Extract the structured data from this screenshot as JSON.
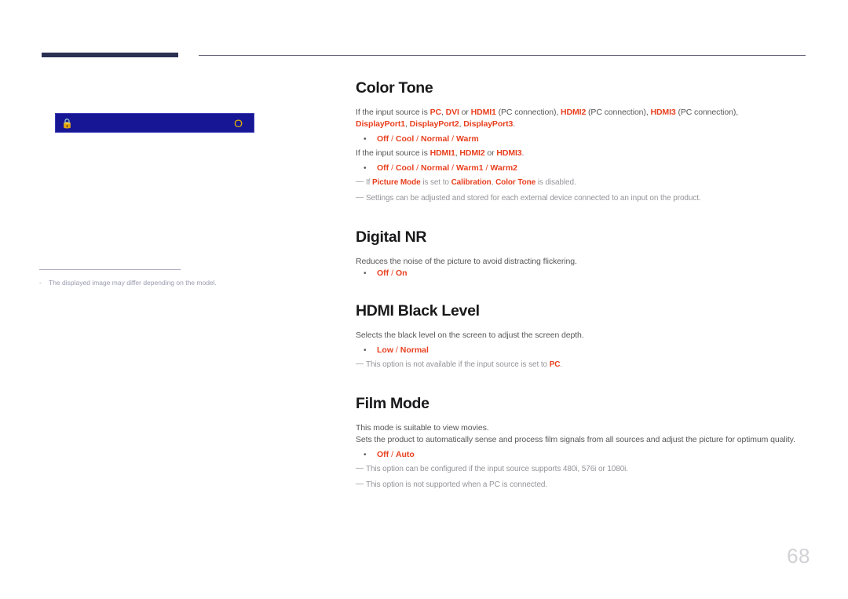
{
  "page": {
    "number": "68",
    "colors": {
      "accent_red": "#e8401f",
      "heading": "#19191b",
      "body_gray": "#58585b",
      "note_gray": "#95959a",
      "rule_navy": "#2b3152",
      "osd_blue": "#171796",
      "osd_yellow": "#e8b400",
      "page_number_gray": "#d2d2d6"
    }
  },
  "illustration": {
    "osd_bar": {
      "left_icon": "lock-icon",
      "right_icon": "circle-o-icon",
      "right_label": "O"
    },
    "footnote": {
      "dash": "-",
      "text": "The displayed image may differ depending on the model."
    }
  },
  "sections": [
    {
      "title": "Color Tone",
      "blocks": [
        {
          "type": "rich",
          "parts": [
            {
              "t": "If the input source is ",
              "hl": false
            },
            {
              "t": "PC",
              "hl": true
            },
            {
              "t": ", ",
              "hl": false
            },
            {
              "t": "DVI",
              "hl": true
            },
            {
              "t": " or ",
              "hl": false
            },
            {
              "t": "HDMI1",
              "hl": true
            },
            {
              "t": " (PC connection), ",
              "hl": false
            },
            {
              "t": "HDMI2",
              "hl": true
            },
            {
              "t": " (PC connection), ",
              "hl": false
            },
            {
              "t": "HDMI3",
              "hl": true
            },
            {
              "t": " (PC connection), ",
              "hl": false
            }
          ]
        },
        {
          "type": "rich",
          "parts": [
            {
              "t": "DisplayPort1",
              "hl": true
            },
            {
              "t": ", ",
              "hl": false
            },
            {
              "t": "DisplayPort2",
              "hl": true
            },
            {
              "t": ", ",
              "hl": false
            },
            {
              "t": "DisplayPort3",
              "hl": true
            },
            {
              "t": ".",
              "hl": false
            }
          ]
        },
        {
          "type": "options",
          "bullet": "•",
          "options": [
            "Off",
            "Cool",
            "Normal",
            "Warm"
          ]
        },
        {
          "type": "rich",
          "parts": [
            {
              "t": "If the input source is ",
              "hl": false
            },
            {
              "t": "HDMI1",
              "hl": true
            },
            {
              "t": ", ",
              "hl": false
            },
            {
              "t": "HDMI2",
              "hl": true
            },
            {
              "t": " or ",
              "hl": false
            },
            {
              "t": "HDMI3",
              "hl": true
            },
            {
              "t": ".",
              "hl": false
            }
          ]
        },
        {
          "type": "options",
          "bullet": "•",
          "options": [
            "Off",
            "Cool",
            "Normal",
            "Warm1",
            "Warm2"
          ]
        },
        {
          "type": "note",
          "parts": [
            {
              "t": "If ",
              "hl": false
            },
            {
              "t": "Picture Mode",
              "hl": true
            },
            {
              "t": " is set to ",
              "hl": false
            },
            {
              "t": "Calibration",
              "hl": true
            },
            {
              "t": ", ",
              "hl": false
            },
            {
              "t": "Color Tone",
              "hl": true
            },
            {
              "t": " is disabled.",
              "hl": false
            }
          ]
        },
        {
          "type": "note",
          "parts": [
            {
              "t": "Settings can be adjusted and stored for each external device connected to an input on the product.",
              "hl": false
            }
          ]
        }
      ]
    },
    {
      "title": "Digital NR",
      "blocks": [
        {
          "type": "rich",
          "parts": [
            {
              "t": "Reduces the noise of the picture to avoid distracting flickering.",
              "hl": false
            }
          ]
        },
        {
          "type": "options",
          "bullet": "•",
          "options": [
            "Off",
            "On"
          ],
          "tight": true
        }
      ]
    },
    {
      "title": "HDMI Black Level",
      "blocks": [
        {
          "type": "rich",
          "parts": [
            {
              "t": "Selects the black level on the screen to adjust the screen depth.",
              "hl": false
            }
          ]
        },
        {
          "type": "options",
          "bullet": "•",
          "options": [
            "Low",
            "Normal"
          ]
        },
        {
          "type": "note",
          "parts": [
            {
              "t": "This option is not available if the input source is set to ",
              "hl": false
            },
            {
              "t": "PC",
              "hl": true
            },
            {
              "t": ".",
              "hl": false
            }
          ]
        }
      ]
    },
    {
      "title": "Film Mode",
      "blocks": [
        {
          "type": "rich",
          "parts": [
            {
              "t": "This mode is suitable to view movies.",
              "hl": false
            }
          ]
        },
        {
          "type": "rich",
          "parts": [
            {
              "t": "Sets the product to automatically sense and process film signals from all sources and adjust the picture for optimum quality.",
              "hl": false
            }
          ]
        },
        {
          "type": "options",
          "bullet": "•",
          "options": [
            "Off",
            "Auto"
          ]
        },
        {
          "type": "note",
          "parts": [
            {
              "t": "This option can be configured if the input source supports 480i, 576i or 1080i.",
              "hl": false
            }
          ]
        },
        {
          "type": "note",
          "parts": [
            {
              "t": "This option is not supported when a PC is connected.",
              "hl": false
            }
          ]
        }
      ]
    }
  ]
}
